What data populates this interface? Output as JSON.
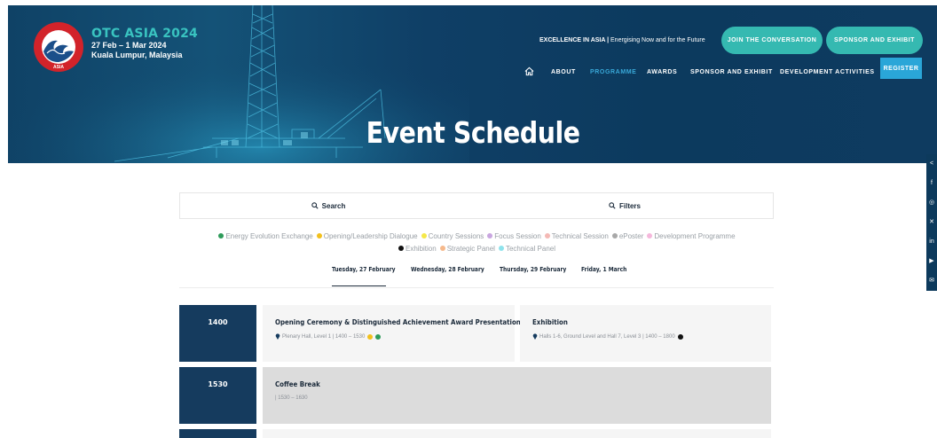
{
  "header": {
    "logo_ring_text": "OFFSHORE TECHNOLOGY CONFERENCE",
    "logo_seal_text": "ASIA",
    "event_name": "OTC ASIA 2024",
    "dates": "27 Feb – 1 Mar 2024",
    "location": "Kuala Lumpur, Malaysia",
    "tagline_bold": "EXCELLENCE IN ASIA |",
    "tagline_rest": "Energising Now and for the Future",
    "join_button": "JOIN THE CONVERSATION",
    "sponsor_button": "SPONSOR AND EXHIBIT",
    "nav": [
      {
        "label": "ABOUT",
        "active": false
      },
      {
        "label": "PROGRAMME",
        "active": true
      },
      {
        "label": "AWARDS",
        "active": false
      },
      {
        "label": "SPONSOR AND EXHIBIT",
        "active": false
      },
      {
        "label": "DEVELOPMENT ACTIVITIES",
        "active": false
      }
    ],
    "register_button": "REGISTER",
    "page_title": "Event Schedule"
  },
  "social_icons": [
    "share-icon",
    "facebook-icon",
    "instagram-icon",
    "x-icon",
    "linkedin-icon",
    "youtube-icon",
    "email-icon"
  ],
  "search_label": "Search",
  "filters_label": "Filters",
  "legend": [
    {
      "label": "Energy Evolution Exchange",
      "color": "#2e9b5a"
    },
    {
      "label": "Opening/Leadership Dialogue",
      "color": "#f2c01c"
    },
    {
      "label": "Country Sessions",
      "color": "#f5e84a"
    },
    {
      "label": "Focus Session",
      "color": "#c9a6e0"
    },
    {
      "label": "Technical Session",
      "color": "#f4b9b5"
    },
    {
      "label": "ePoster",
      "color": "#a8a8a8"
    },
    {
      "label": "Development Programme",
      "color": "#f5b8dc"
    },
    {
      "label": "Exhibition",
      "color": "#111111"
    },
    {
      "label": "Strategic Panel",
      "color": "#f6b98c"
    },
    {
      "label": "Technical Panel",
      "color": "#8fe3ec"
    }
  ],
  "days": [
    {
      "label": "Tuesday, 27 February",
      "active": true
    },
    {
      "label": "Wednesday, 28 February",
      "active": false
    },
    {
      "label": "Thursday, 29 February",
      "active": false
    },
    {
      "label": "Friday, 1 March",
      "active": false
    }
  ],
  "schedule": [
    {
      "time": "1400",
      "events": [
        {
          "title": "Opening Ceremony & Distinguished Achievement Award Presentation",
          "meta": "Plenary Hall, Level 1 | 1400 – 1530",
          "dot_colors": [
            "#f2c01c",
            "#2e9b5a"
          ]
        },
        {
          "title": "Exhibition",
          "meta": "Halls 1-6, Ground Level and Hall 7, Level 3 | 1400 – 1800",
          "dot_colors": [
            "#111111"
          ]
        }
      ]
    },
    {
      "time": "1530",
      "events": [
        {
          "title": "Coffee Break",
          "meta": "| 1530 – 1630",
          "dot_colors": []
        }
      ]
    }
  ]
}
